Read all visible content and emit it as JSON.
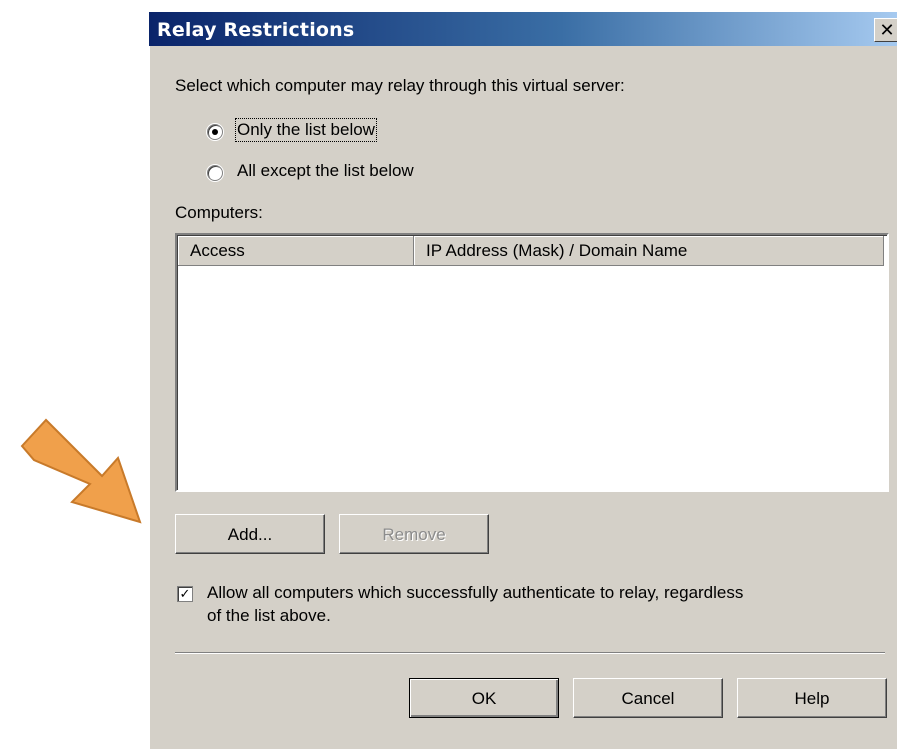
{
  "dialog": {
    "title": "Relay Restrictions",
    "close_glyph": "✕",
    "instruction": "Select which computer may relay through this virtual server:",
    "radios": [
      {
        "label": "Only the list below",
        "checked": true
      },
      {
        "label": "All except the list below",
        "checked": false
      }
    ],
    "computers_label": "Computers:",
    "columns": [
      "Access",
      "IP Address (Mask) / Domain Name"
    ],
    "buttons": {
      "add": "Add...",
      "remove": "Remove",
      "ok": "OK",
      "cancel": "Cancel",
      "help": "Help"
    },
    "checkbox": {
      "line1": "Allow all computers which successfully authenticate to relay, regardless",
      "line2": "of the list above.",
      "checked": true
    }
  },
  "colors": {
    "arrow": "#f0a04b",
    "title_start": "#0a246a",
    "title_end": "#a6caf0"
  },
  "icons": {
    "arrow": "arrow-right-icon",
    "close": "close-icon",
    "check": "check-icon"
  }
}
